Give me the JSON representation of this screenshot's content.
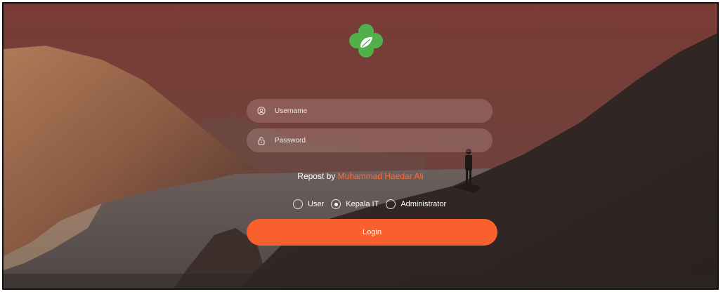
{
  "app": {
    "logo_name": "leaf-cross-logo",
    "colors": {
      "accent": "#f9602d",
      "author_highlight": "#ff6a3a",
      "logo_green": "#4caf50"
    }
  },
  "form": {
    "username": {
      "placeholder": "Username",
      "value": "",
      "icon": "user-icon"
    },
    "password": {
      "placeholder": "Password",
      "value": "",
      "icon": "lock-icon"
    },
    "credit_prefix": "Repost by ",
    "credit_author": "Muhammad Haedar Ali",
    "roles": [
      {
        "label": "User",
        "selected": false
      },
      {
        "label": "Kepala IT",
        "selected": true
      },
      {
        "label": "Administrator",
        "selected": false
      }
    ],
    "login_label": "Login"
  }
}
